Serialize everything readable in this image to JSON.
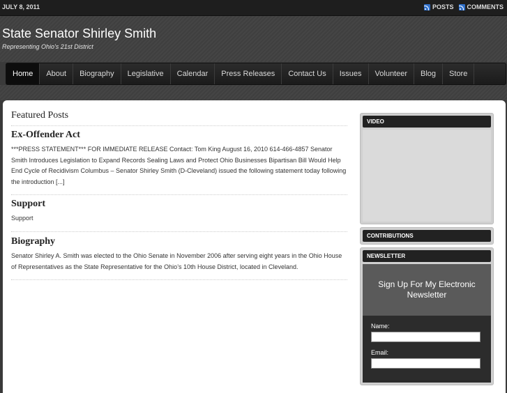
{
  "topbar": {
    "date": "JULY 8, 2011",
    "posts_label": "POSTS",
    "comments_label": "COMMENTS"
  },
  "header": {
    "title": "State Senator Shirley Smith",
    "tagline": "Representing Ohio's 21st District"
  },
  "nav": {
    "items": [
      "Home",
      "About",
      "Biography",
      "Legislative",
      "Calendar",
      "Press Releases",
      "Contact Us",
      "Issues",
      "Volunteer",
      "Blog",
      "Store"
    ]
  },
  "main": {
    "heading": "Featured Posts",
    "posts": [
      {
        "title": "Ex-Offender Act",
        "excerpt": "***PRESS STATEMENT*** FOR IMMEDIATE RELEASE            Contact: Tom King August 16, 2010 614-466-4857 Senator Smith Introduces Legislation to Expand Records Sealing Laws and Protect Ohio Businesses Bipartisan Bill Would Help End Cycle of Recidivism Columbus – Senator Shirley Smith (D-Cleveland) issued the following statement today following the introduction [...]"
      },
      {
        "title": "Support",
        "excerpt": "Support"
      },
      {
        "title": "Biography",
        "excerpt": "Senator Shirley A. Smith was elected to the Ohio Senate in November 2006 after serving eight years in the Ohio House of Representatives as the State Representative for the Ohio’s 10th House District, located in Cleveland."
      }
    ]
  },
  "sidebar": {
    "video_title": "VIDEO",
    "contributions_title": "CONTRIBUTIONS",
    "newsletter_title": "NEWSLETTER",
    "newsletter_heading": "Sign Up For My Electronic Newsletter",
    "name_label": "Name:",
    "email_label": "Email:"
  }
}
